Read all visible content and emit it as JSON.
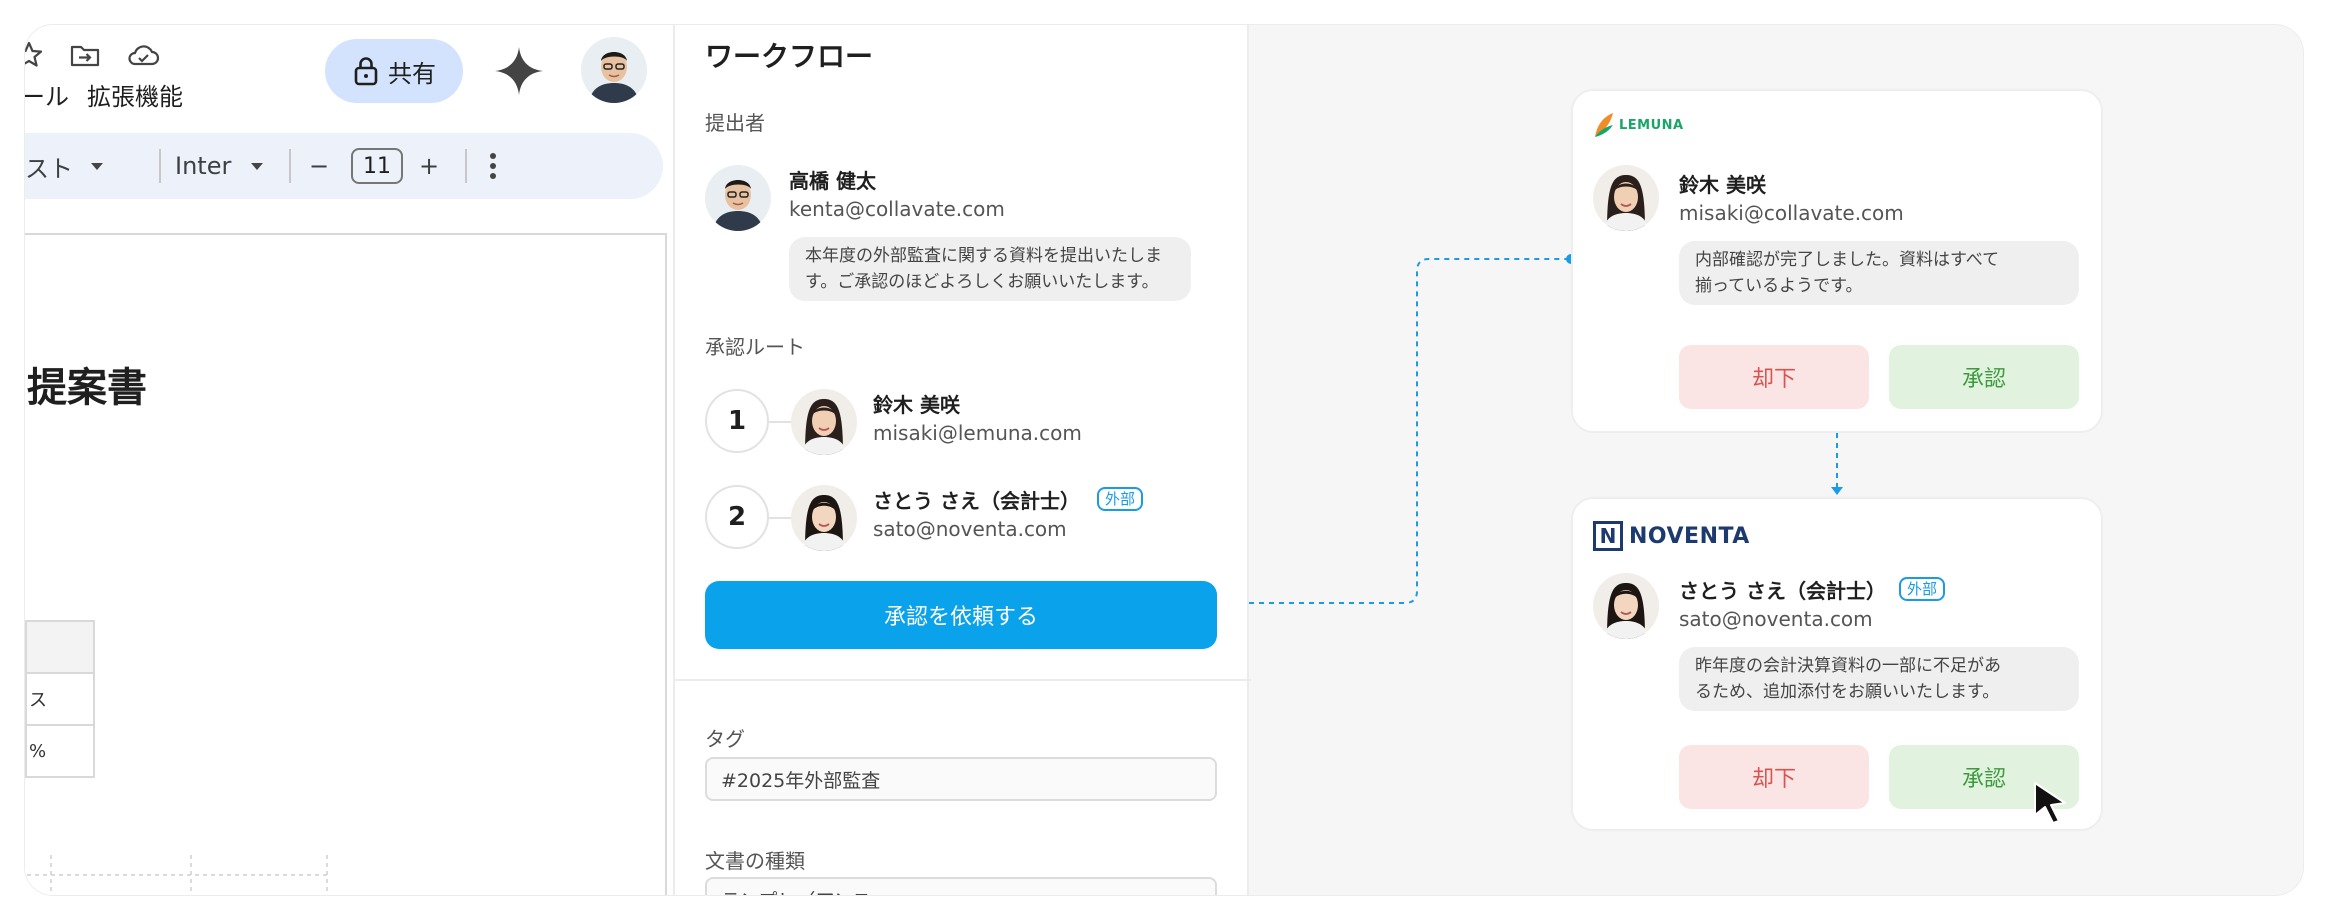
{
  "editor": {
    "menu_items": [
      "ール",
      "拡張機能"
    ],
    "share_label": "共有",
    "toolbar": {
      "style_label": "スト",
      "font_label": "Inter",
      "minus": "−",
      "font_size": "11",
      "plus": "+"
    },
    "page_title": "提案書",
    "table_cells": [
      "",
      "ス",
      "%"
    ]
  },
  "workflow": {
    "title": "ワークフロー",
    "submitter_label": "提出者",
    "submitter": {
      "name": "高橋 健太",
      "email": "kenta@collavate.com",
      "message_line1": "本年度の外部監査に関する資料を提出いたしま",
      "message_line2": "す。ご承認のほどよろしくお願いいたします。"
    },
    "route_label": "承認ルート",
    "route": [
      {
        "step": "1",
        "name": "鈴木 美咲",
        "email": "misaki@lemuna.com",
        "badge": ""
      },
      {
        "step": "2",
        "name": "さとう さえ（会計士）",
        "email": "sato@noventa.com",
        "badge": "外部"
      }
    ],
    "request_button": "承認を依頼する",
    "tag_label": "タグ",
    "tag_value": "#2025年外部監査",
    "doc_type_label": "文書の種類",
    "doc_type_value": "テンプレ（アンス"
  },
  "cards": [
    {
      "company": "LEMUNA",
      "name": "鈴木 美咲",
      "email": "misaki@collavate.com",
      "badge": "",
      "comment_line1": "内部確認が完了しました。資料はすべて",
      "comment_line2": "揃っているようです。",
      "reject": "却下",
      "approve": "承認"
    },
    {
      "company": "NOVENTA",
      "name": "さとう さえ（会計士）",
      "email": "sato@noventa.com",
      "badge": "外部",
      "comment_line1": "昨年度の会計決算資料の一部に不足があ",
      "comment_line2": "るため、追加添付をお願いいたします。",
      "reject": "却下",
      "approve": "承認"
    }
  ],
  "colors": {
    "accent": "#0aa2ea",
    "reject_bg": "#fbe5e4",
    "approve_bg": "#e1f3df",
    "external_badge": "#1a9be6"
  }
}
